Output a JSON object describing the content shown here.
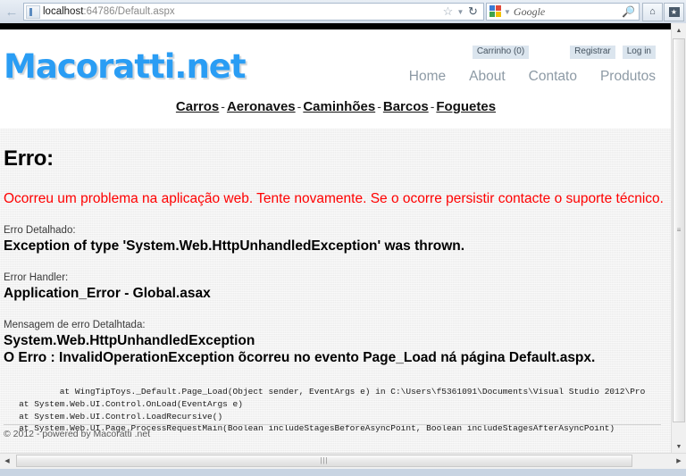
{
  "browser": {
    "back_icon": "back-arrow-icon",
    "url_host": "localhost",
    "url_rest": ":64786/Default.aspx",
    "url_full": "localhost:64786/Default.aspx",
    "bookmark_star_icon": "star-icon",
    "bookmark_caret_icon": "chevron-down-icon",
    "reload_icon": "reload-icon",
    "search_engine": "Google",
    "search_placeholder": "Google",
    "search_icon": "magnifier-icon",
    "search_engine_caret": "chevron-down-icon",
    "home_icon": "home-icon",
    "bookmark_button_icon": "bookmark-star-icon"
  },
  "site": {
    "logo": "Macoratti.net",
    "account": {
      "cart_label": "Carrinho (0)",
      "register_label": "Registrar",
      "login_label": "Log in"
    },
    "nav": [
      {
        "label": "Home"
      },
      {
        "label": "About"
      },
      {
        "label": "Contato"
      },
      {
        "label": "Produtos"
      }
    ],
    "categories": [
      {
        "label": "Carros"
      },
      {
        "label": "Aeronaves"
      },
      {
        "label": "Caminhões"
      },
      {
        "label": "Barcos"
      },
      {
        "label": "Foguetes"
      }
    ],
    "category_separator": "-",
    "footer": "© 2012 - powered by Macoratti .net"
  },
  "error_page": {
    "title": "Erro:",
    "message": "Ocorreu um problema na aplicação web. Tente novamente. Se o ocorre persistir contacte o suporte técnico.",
    "detail_label": "Erro Detalhado:",
    "detail_value": "Exception of type 'System.Web.HttpUnhandledException' was thrown.",
    "handler_label": "Error Handler:",
    "handler_value": "Application_Error - Global.asax",
    "detailed_message_label": "Mensagem de erro Detalhtada:",
    "detailed_message_line1": "System.Web.HttpUnhandledException",
    "detailed_message_line2": "O Erro : InvalidOperationException õcorreu no evento Page_Load ná página Default.aspx.",
    "stack_trace": "           at WingTipToys._Default.Page_Load(Object sender, EventArgs e) in C:\\Users\\f5361091\\Documents\\Visual Studio 2012\\Pro\n   at System.Web.UI.Control.OnLoad(EventArgs e)\n   at System.Web.UI.Control.LoadRecursive()\n   at System.Web.UI.Page.ProcessRequestMain(Boolean includeStagesBeforeAsyncPoint, Boolean includeStagesAfterAsyncPoint)"
  },
  "scrollbars": {
    "v_up_icon": "▲",
    "v_down_icon": "▼",
    "v_grip": "≡",
    "h_left_icon": "◀",
    "h_right_icon": "▶",
    "h_grip": "|||"
  },
  "colors": {
    "error_red": "#ff0000",
    "logo_blue": "#2a9df4",
    "nav_grey": "#8d9aa5",
    "accent_button_bg": "#dbe5ee"
  }
}
